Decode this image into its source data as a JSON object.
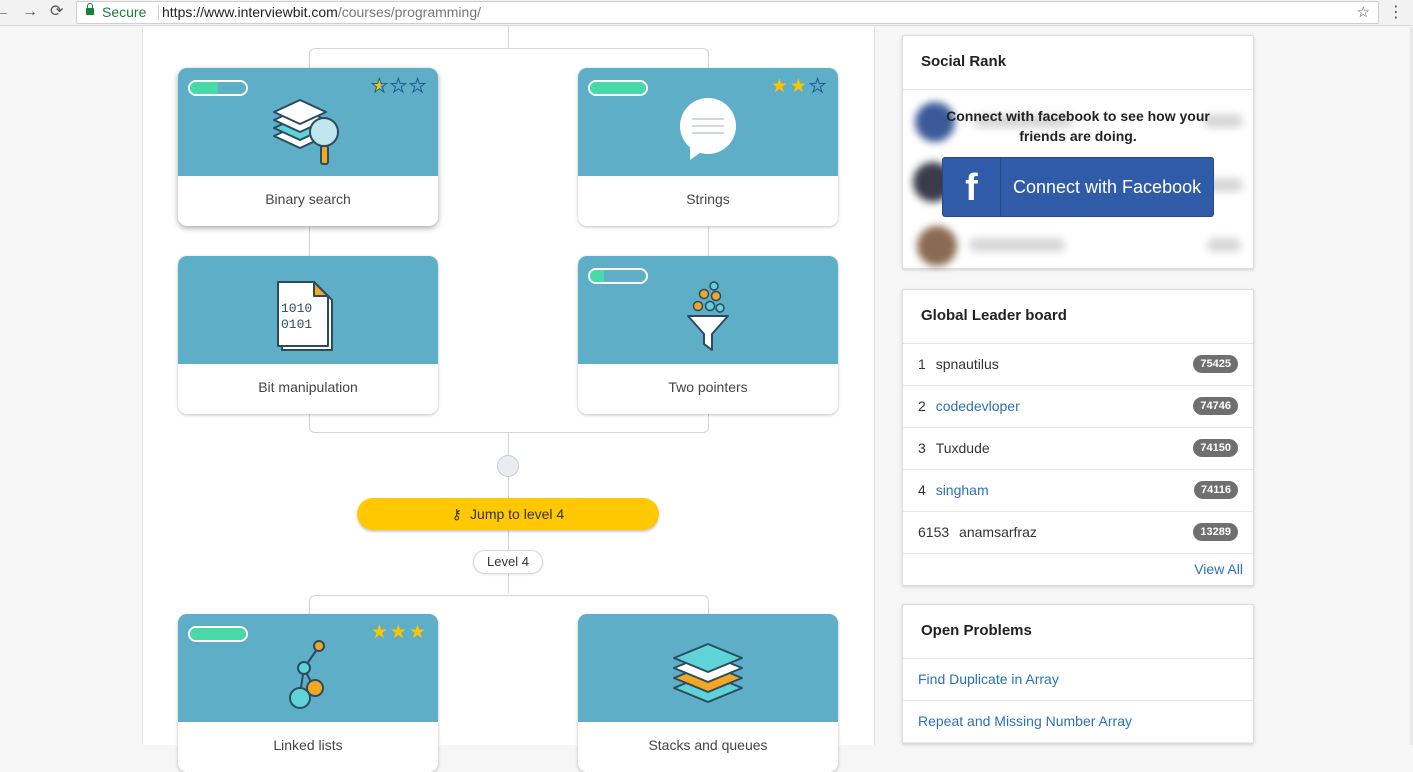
{
  "browser": {
    "back": "←",
    "forward": "→",
    "reload": "⟳",
    "secure_label": "Secure",
    "url_host": "https://www.interviewbit.com",
    "url_path": "/courses/programming/",
    "bookmark": "☆",
    "menu": "⋮"
  },
  "topics": [
    {
      "label": "Binary search",
      "progress": 0.5,
      "stars": [
        0.5,
        0,
        0
      ],
      "icon": "stack-search-icon"
    },
    {
      "label": "Strings",
      "progress": 1.0,
      "stars": [
        1,
        1,
        0
      ],
      "icon": "speech-bubble-icon"
    },
    {
      "label": "Bit manipulation",
      "progress": null,
      "stars": null,
      "icon": "binary-document-icon"
    },
    {
      "label": "Two pointers",
      "progress": 0.25,
      "stars": null,
      "icon": "funnel-icon"
    },
    {
      "label": "Linked lists",
      "progress": 1.0,
      "stars": [
        1,
        1,
        1
      ],
      "icon": "linked-nodes-icon"
    },
    {
      "label": "Stacks and queues",
      "progress": null,
      "stars": null,
      "icon": "layers-icon"
    }
  ],
  "level": {
    "jump_label": "Jump to level 4",
    "jump_icon": "key-icon",
    "current_level": "Level 4"
  },
  "social_rank": {
    "title": "Social Rank",
    "prompt": "Connect with facebook to see how your friends are doing.",
    "fb_button": "Connect with Facebook",
    "fb_logo": "f"
  },
  "leaderboard": {
    "title": "Global Leader board",
    "rows": [
      {
        "rank": "1",
        "name": "spnautilus",
        "score": "75425",
        "link": false
      },
      {
        "rank": "2",
        "name": "codedevloper",
        "score": "74746",
        "link": true
      },
      {
        "rank": "3",
        "name": "Tuxdude",
        "score": "74150",
        "link": false
      },
      {
        "rank": "4",
        "name": "singham",
        "score": "74116",
        "link": true
      },
      {
        "rank": "6153",
        "name": "anamsarfraz",
        "score": "13289",
        "link": false
      }
    ],
    "view_all": "View All"
  },
  "open_problems": {
    "title": "Open Problems",
    "items": [
      "Find Duplicate in Array",
      "Repeat and Missing Number Array"
    ]
  },
  "colors": {
    "card_top": "#5eaec8",
    "progress_fill": "#48d9a9",
    "star": "#ffc400",
    "jump_button": "#ffc800",
    "facebook": "#2f5ba8",
    "link": "#2a72b5"
  }
}
